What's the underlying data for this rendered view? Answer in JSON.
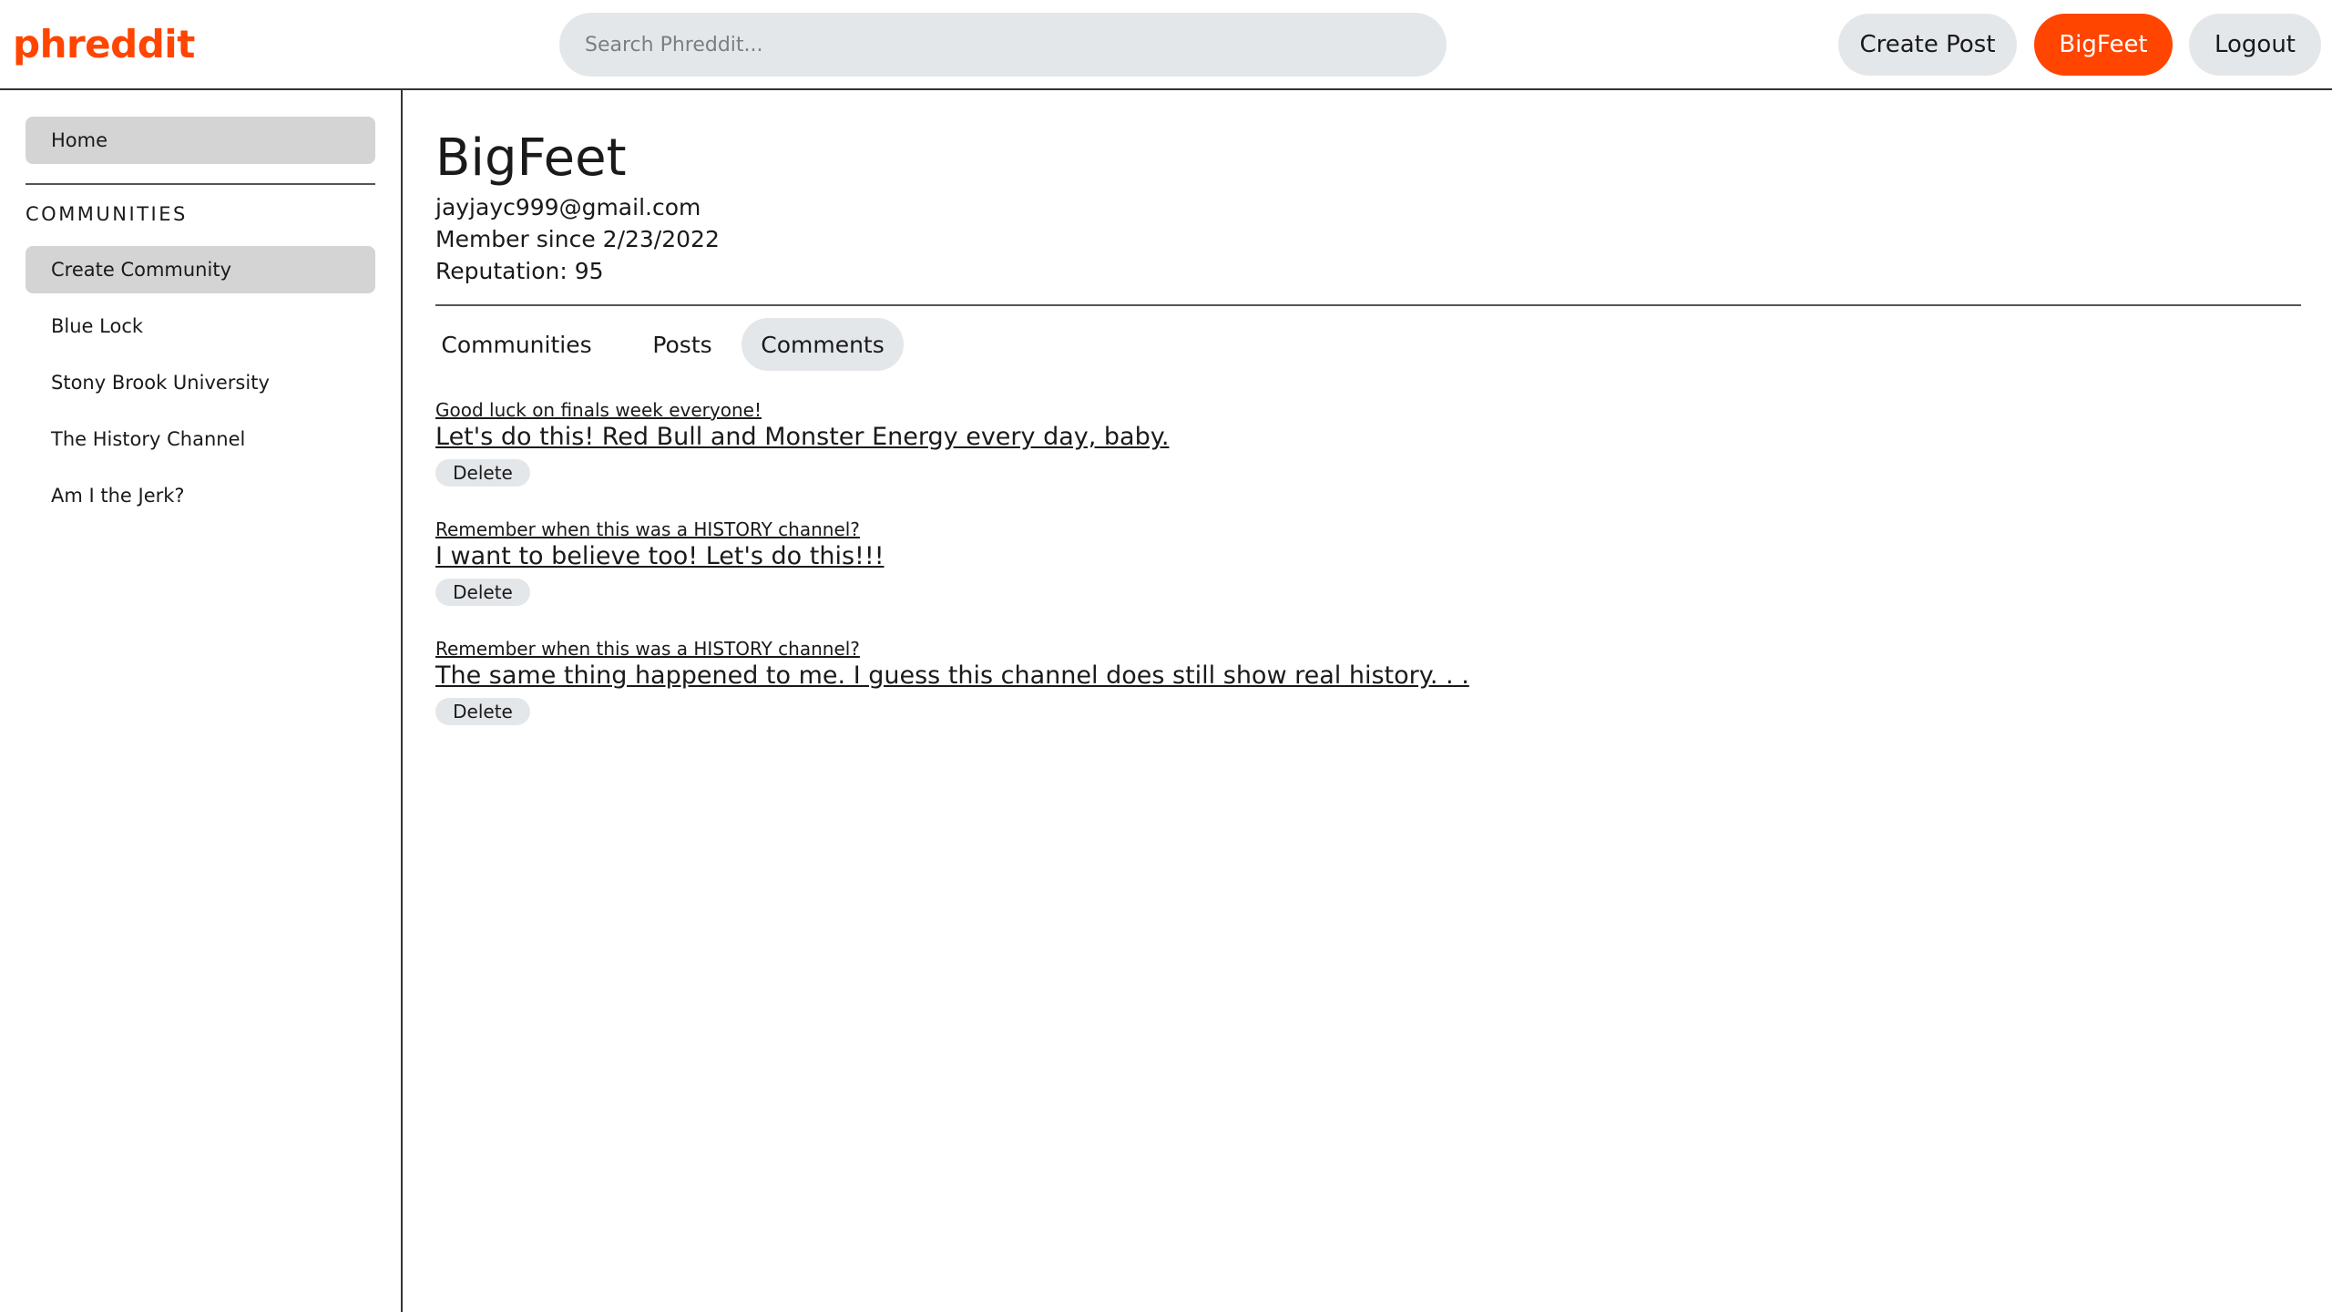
{
  "header": {
    "logo": "phreddit",
    "search_placeholder": "Search Phreddit...",
    "create_post_label": "Create Post",
    "user_label": "BigFeet",
    "logout_label": "Logout"
  },
  "sidebar": {
    "home_label": "Home",
    "section_title": "COMMUNITIES",
    "create_community_label": "Create Community",
    "communities": [
      "Blue Lock",
      "Stony Brook University",
      "The History Channel",
      "Am I the Jerk?"
    ]
  },
  "profile": {
    "username": "BigFeet",
    "email": "jayjayc999@gmail.com",
    "member_since": "Member since 2/23/2022",
    "reputation": "Reputation: 95"
  },
  "tabs": {
    "communities": "Communities",
    "posts": "Posts",
    "comments": "Comments",
    "active": "Comments"
  },
  "comments": [
    {
      "post_title": "Good luck on finals week everyone!",
      "text": "Let's do this! Red Bull and Monster Energy every day, baby.",
      "delete_label": "Delete"
    },
    {
      "post_title": "Remember when this was a HISTORY channel?",
      "text": "I want to believe too! Let's do this!!!",
      "delete_label": "Delete"
    },
    {
      "post_title": "Remember when this was a HISTORY channel?",
      "text": "The same thing happened to me. I guess this channel does still show real history. . .",
      "delete_label": "Delete"
    }
  ],
  "colors": {
    "brand": "#ff4500",
    "button_bg": "#e4e7ea",
    "nav_active_bg": "#d4d4d4"
  }
}
